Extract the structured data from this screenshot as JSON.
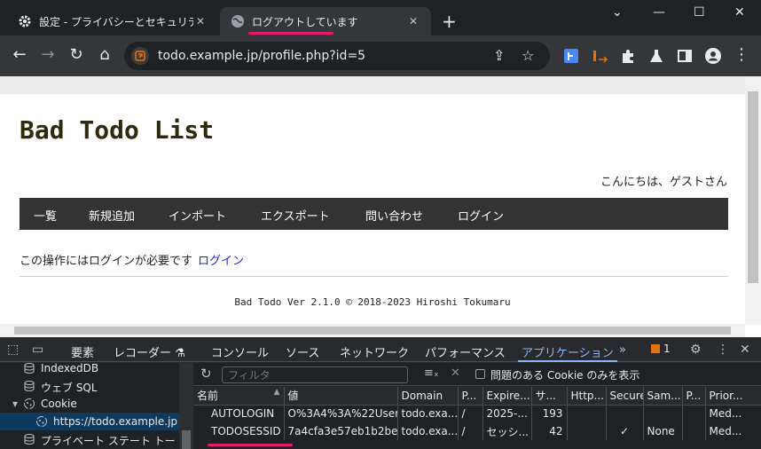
{
  "browser": {
    "tabs": [
      {
        "title": "設定 - プライバシーとセキュリティ",
        "icon": "gear-icon"
      },
      {
        "title": "ログアウトしています",
        "icon": "globe-icon",
        "active": true
      }
    ],
    "new_tab": "+",
    "window_controls": [
      "⌄",
      "—",
      "☐",
      "✕"
    ],
    "url": "todo.example.jp/profile.php?id=5"
  },
  "page": {
    "site_title": "Bad Todo List",
    "greeting": "こんにちは、ゲストさん",
    "menu": [
      "一覧",
      "新規追加",
      "インポート",
      "エクスポート",
      "問い合わせ",
      "ログイン"
    ],
    "notice_text": "この操作にはログインが必要です",
    "notice_link": "ログイン",
    "footer": "Bad Todo Ver 2.1.0 © 2018-2023 Hiroshi Tokumaru"
  },
  "devtools": {
    "tabs": [
      "要素",
      "レコーダー ⚗",
      "コンソール",
      "ソース",
      "ネットワーク",
      "パフォーマンス",
      "アプリケーション"
    ],
    "more": "»",
    "issues_count": "1",
    "sidebar": {
      "items": [
        {
          "label": "IndexedDB",
          "icon": "database-icon"
        },
        {
          "label": "ウェブ SQL",
          "icon": "database-icon"
        },
        {
          "label": "Cookie",
          "icon": "cookie-icon",
          "expanded": true
        },
        {
          "label": "https://todo.example.jp",
          "icon": "cookie-icon",
          "selected": true
        },
        {
          "label": "プライベート ステート トー",
          "icon": "database-icon"
        }
      ]
    },
    "filter_placeholder": "フィルタ",
    "problem_cookie_label": "問題のある Cookie のみを表示",
    "columns": [
      "名前",
      "値",
      "Domain",
      "P...",
      "Expire...",
      "サ...",
      "Http...",
      "Secure",
      "Sam...",
      "P...",
      "Prior..."
    ],
    "sort_indicator": "▲",
    "rows": [
      [
        "AUTOLOGIN",
        "O%3A4%3A%22User...",
        "todo.exa...",
        "/",
        "2025-...",
        "193",
        "",
        "",
        "",
        "",
        "Med..."
      ],
      [
        "TODOSESSID",
        "7a4cfa3e57eb1b2be...",
        "todo.exa...",
        "/",
        "セッシ...",
        "42",
        "",
        "✓",
        "None",
        "",
        "Med..."
      ]
    ]
  }
}
